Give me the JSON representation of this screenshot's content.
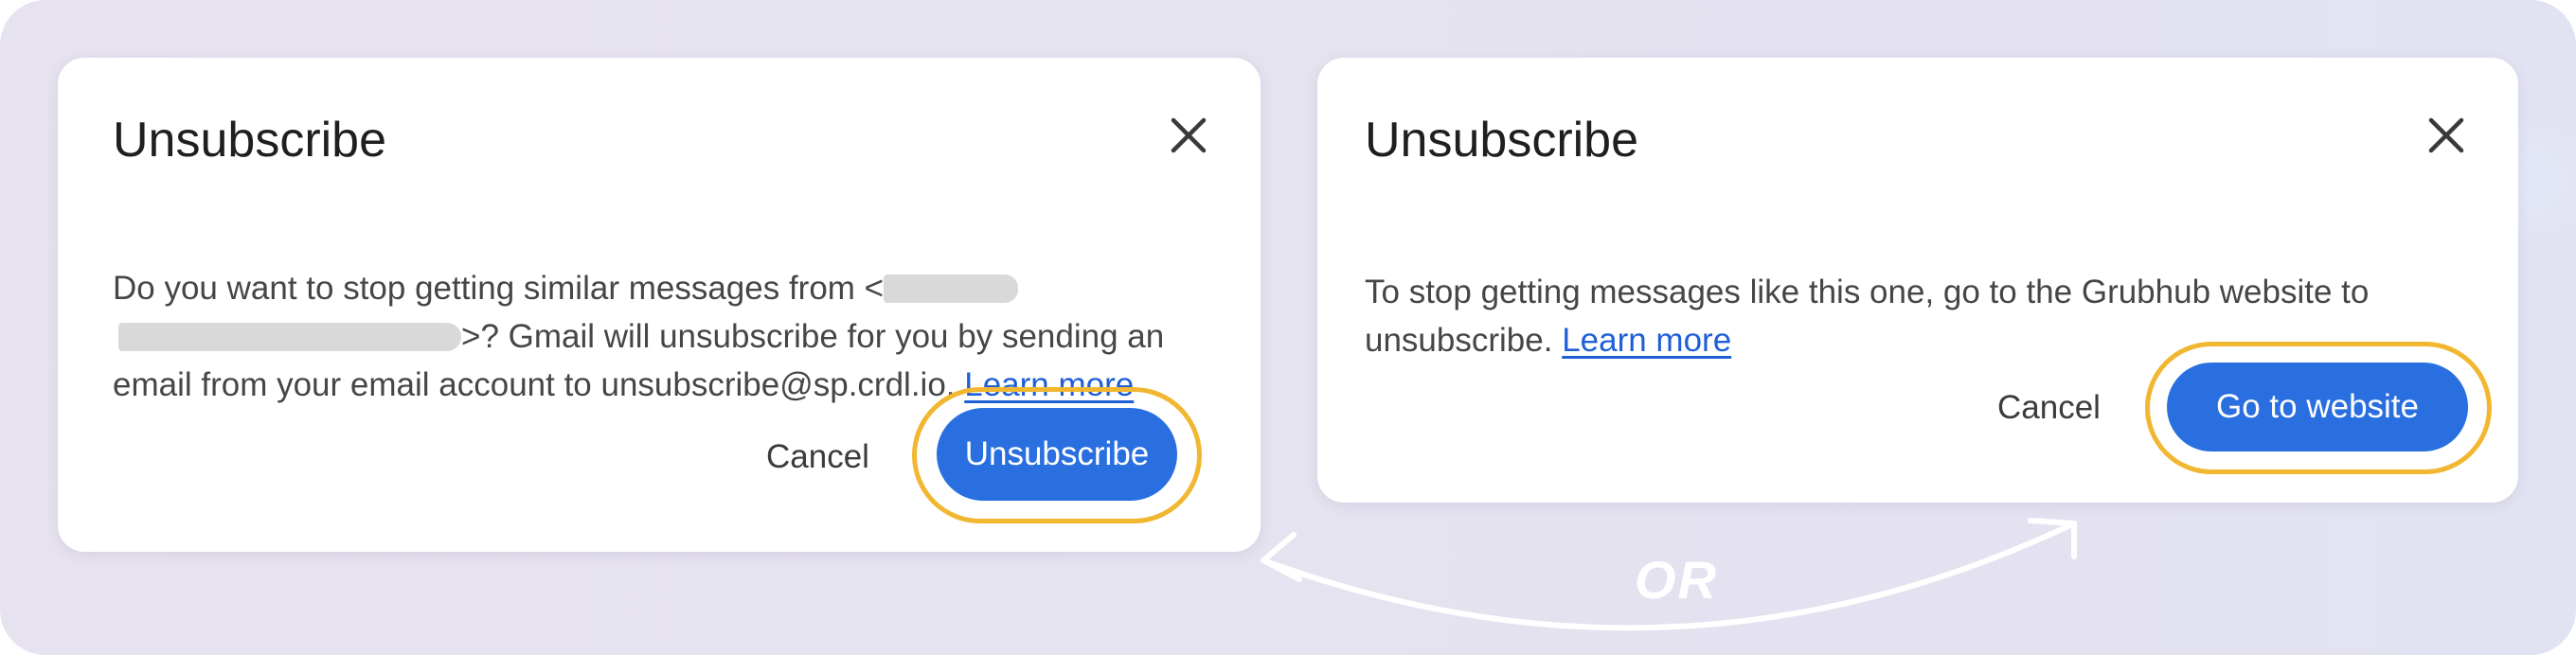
{
  "colors": {
    "background": "#e6e3f0",
    "primary_button": "#2a6fe0",
    "highlight_ring": "#f1b731",
    "link": "#1f5fd6"
  },
  "left_dialog": {
    "title": "Unsubscribe",
    "close_icon": "close-icon",
    "body": {
      "text_before_redacted": "Do you want to stop getting similar messages from <",
      "text_after_redacted": ">? Gmail will unsubscribe for you by sending an email from your email account to unsubscribe@sp.crdl.io.",
      "learn_more": "Learn more"
    },
    "cancel_label": "Cancel",
    "primary_label": "Unsubscribe"
  },
  "right_dialog": {
    "title": "Unsubscribe",
    "close_icon": "close-icon",
    "body": {
      "text": "To stop getting messages like this one, go to the Grubhub website to unsubscribe.",
      "learn_more": "Learn more"
    },
    "cancel_label": "Cancel",
    "primary_label": "Go to website"
  },
  "connector": {
    "label": "OR",
    "icon": "double-arrow-icon"
  }
}
